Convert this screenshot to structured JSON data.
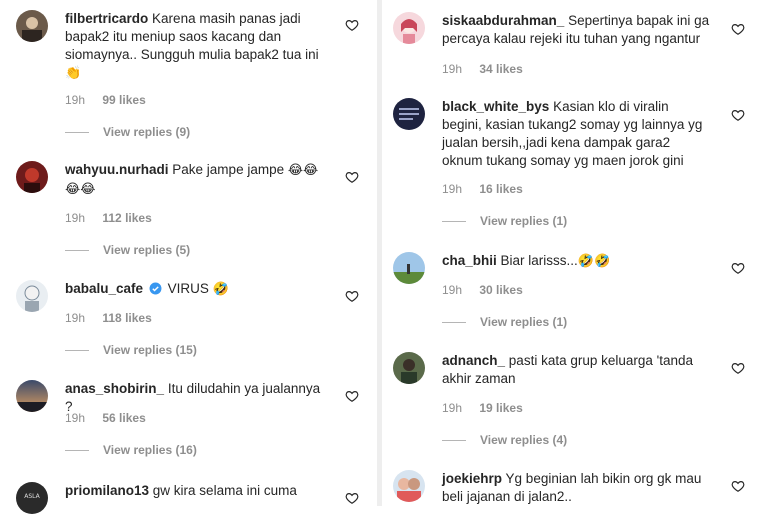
{
  "left": [
    {
      "username": "filbertricardo",
      "verified": false,
      "text": "Karena masih panas jadi bapak2 itu meniup saos kacang dan siomaynya.. Sungguh mulia bapak2 tua ini",
      "emoji": "👏",
      "time": "19h",
      "likes": "99 likes",
      "replies": "View replies (9)"
    },
    {
      "username": "wahyuu.nurhadi",
      "verified": false,
      "text": "Pake jampe jampe",
      "emoji": "😂😂😂😂",
      "time": "19h",
      "likes": "112 likes",
      "replies": "View replies (5)"
    },
    {
      "username": "babalu_cafe",
      "verified": true,
      "text": "VIRUS",
      "emoji": "🤣",
      "time": "19h",
      "likes": "118 likes",
      "replies": "View replies (15)"
    },
    {
      "username": "anas_shobirin_",
      "verified": false,
      "text": "Itu diludahin ya jualannya ?",
      "emoji": "",
      "time": "19h",
      "likes": "56 likes",
      "replies": "View replies (16)"
    },
    {
      "username": "priomilano13",
      "verified": false,
      "text": "gw kira selama ini cuma",
      "emoji": "",
      "time": "",
      "likes": "",
      "replies": ""
    }
  ],
  "right": [
    {
      "username": "siskaabdurahman_",
      "verified": false,
      "text": "Sepertinya bapak ini ga percaya kalau rejeki itu tuhan yang ngantur",
      "emoji": "",
      "time": "19h",
      "likes": "34 likes",
      "replies": ""
    },
    {
      "username": "black_white_bys",
      "verified": false,
      "text": "Kasian klo di viralin begini, kasian tukang2 somay yg lainnya yg jualan bersih,,jadi kena dampak gara2 oknum tukang somay yg maen jorok gini",
      "emoji": "",
      "time": "19h",
      "likes": "16 likes",
      "replies": "View replies (1)"
    },
    {
      "username": "cha_bhii",
      "verified": false,
      "text": "Biar larisss...",
      "emoji": "🤣🤣",
      "time": "19h",
      "likes": "30 likes",
      "replies": "View replies (1)"
    },
    {
      "username": "adnanch_",
      "verified": false,
      "text": "pasti kata grup keluarga 'tanda akhir zaman",
      "emoji": "",
      "time": "19h",
      "likes": "19 likes",
      "replies": "View replies (4)"
    },
    {
      "username": "joekiehrp",
      "verified": false,
      "text": "Yg beginian lah bikin org gk mau beli jajanan di jalan2..",
      "emoji": "",
      "time": "",
      "likes": "",
      "replies": ""
    }
  ],
  "colors": {
    "text": "#262626",
    "meta": "#8e8e8e",
    "verified": "#3897f0"
  },
  "icons": {
    "like": "heart-outline-icon",
    "verified": "verified-badge-icon"
  }
}
